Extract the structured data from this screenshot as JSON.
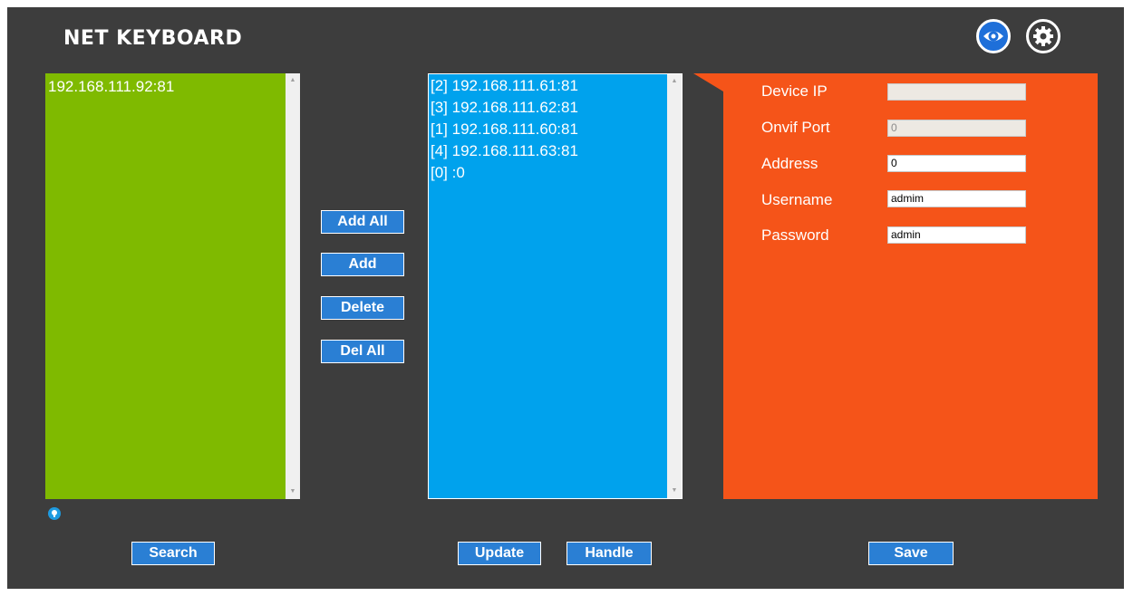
{
  "app": {
    "title": "NET  KEYBOARD"
  },
  "header_icons": {
    "view": "eye-icon",
    "settings": "gear-icon"
  },
  "left_list": {
    "items": [
      "192.168.111.92:81"
    ]
  },
  "middle_list": {
    "items": [
      "[2] 192.168.111.61:81",
      "[3] 192.168.111.62:81",
      "[1] 192.168.111.60:81",
      "[4] 192.168.111.63:81",
      "[0] :0"
    ]
  },
  "transfer_buttons": {
    "add_all": "Add All",
    "add": "Add",
    "delete": "Delete",
    "del_all": "Del All"
  },
  "device_panel": {
    "fields": [
      {
        "label": "Device IP",
        "value": "",
        "disabled": true
      },
      {
        "label": "Onvif Port",
        "value": "0",
        "disabled": true
      },
      {
        "label": "Address",
        "value": "0",
        "disabled": false
      },
      {
        "label": "Username",
        "value": "admim",
        "disabled": false
      },
      {
        "label": "Password",
        "value": "admin",
        "disabled": false
      }
    ]
  },
  "bottom_buttons": {
    "search": "Search",
    "update": "Update",
    "handle": "Handle",
    "save": "Save"
  },
  "colors": {
    "background": "#3d3d3d",
    "left_list": "#7fba00",
    "middle_list": "#00a2ed",
    "panel": "#f55419",
    "button": "#2a7fd4"
  }
}
